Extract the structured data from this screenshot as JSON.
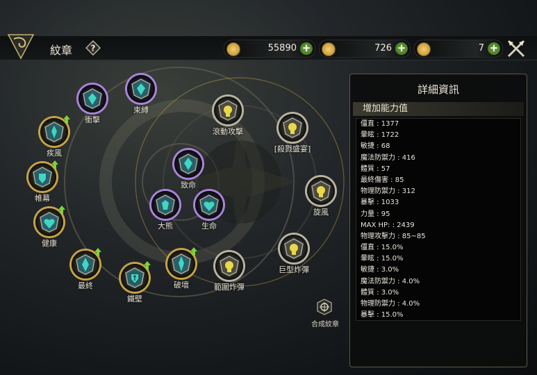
{
  "header": {
    "title": "紋章"
  },
  "resources": [
    {
      "value": "55890"
    },
    {
      "value": "726"
    },
    {
      "value": "7"
    }
  ],
  "panel": {
    "title": "詳細資訊",
    "subtitle": "增加能力值",
    "stats": [
      "僵直 : 1377",
      "暈眩 : 1722",
      "敏捷 : 68",
      "魔法防禦力 : 416",
      "體質 : 57",
      "最終傷害 : 85",
      "物理防禦力 : 312",
      "暴擊 : 1033",
      "力量 : 95",
      "MAX HP:  : 2439",
      "物理攻擊力 : 85~85",
      "僵直 : 15.0%",
      "暈眩 : 15.0%",
      "敏捷 : 3.0%",
      "魔法防禦力 : 4.0%",
      "體質 : 3.0%",
      "物理防禦力 : 4.0%",
      "暴擊 : 15.0%"
    ]
  },
  "nodes": {
    "chongji": "衝擊",
    "shufu": "束縛",
    "jifeng": "疾風",
    "weimu": "帷幕",
    "jiankang": "健康",
    "zuizhong": "最終",
    "tiebi": "鐵壁",
    "pohuai": "破壞",
    "fanwei": "範圍炸彈",
    "juxing": "巨型炸彈",
    "xuanfeng": "旋風",
    "shalu": "[殺戮盛宴]",
    "gundong": "滾動攻擊",
    "zhiming": "致命",
    "daxiong": "大熊",
    "shengming": "生命"
  },
  "synthesize": {
    "label": "合成紋章"
  },
  "colors": {
    "gold_ring": "#c8a245",
    "purple_ring": "#a985d8",
    "grey_ring": "#b9b39e",
    "gem_teal": "#3fd6c4",
    "gem_yellow": "#e8d84a",
    "upgrade_arrow": "#7ad43a"
  }
}
